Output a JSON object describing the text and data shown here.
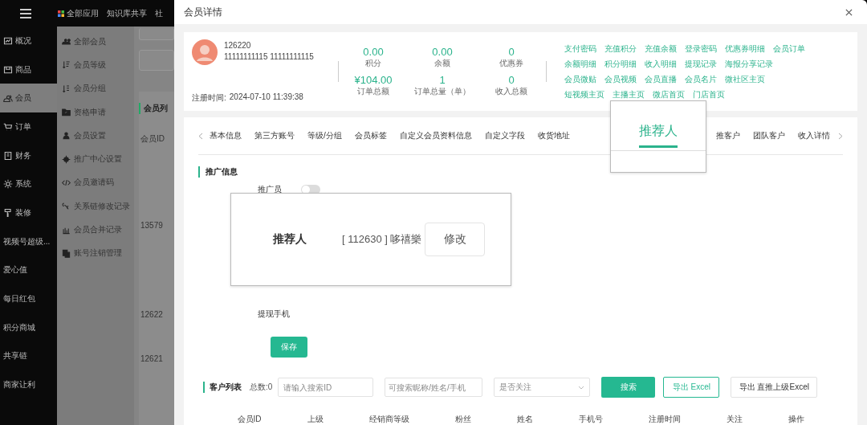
{
  "top_nav": {
    "items": [
      "全部应用",
      "知识库共享",
      "社"
    ]
  },
  "sidebar": {
    "items": [
      {
        "label": "概况",
        "selected": false
      },
      {
        "label": "商品",
        "selected": false
      },
      {
        "label": "会员",
        "selected": true
      },
      {
        "label": "订单",
        "selected": false
      },
      {
        "label": "财务",
        "selected": false
      },
      {
        "label": "系统",
        "selected": false
      },
      {
        "label": "装修",
        "selected": false
      },
      {
        "label": "视频号超级...",
        "selected": false
      },
      {
        "label": "爱心值",
        "selected": false
      },
      {
        "label": "每日红包",
        "selected": false
      },
      {
        "label": "积分商城",
        "selected": false
      },
      {
        "label": "共享链",
        "selected": false
      },
      {
        "label": "商家让利",
        "selected": false
      }
    ]
  },
  "submenu": {
    "items": [
      "全部会员",
      "会员等级",
      "会员分组",
      "资格申请",
      "会员设置",
      "推广中心设置",
      "会员邀请码",
      "关系链修改记录",
      "会员合并记录",
      "账号注销管理"
    ]
  },
  "background": {
    "list_title": "会员列",
    "column": "会员ID",
    "rows": [
      "13579",
      "12622",
      "12621"
    ]
  },
  "modal": {
    "title": "会员详情"
  },
  "member": {
    "id": "126220",
    "phones": "11111111115 11111111115",
    "registered_label": "注册时间:",
    "registered_at": "2024-07-10 11:39:38"
  },
  "stats": [
    {
      "value": "0.00",
      "label": "积分"
    },
    {
      "value": "0.00",
      "label": "余额"
    },
    {
      "value": "0",
      "label": "优惠券"
    },
    {
      "value": "¥104.00",
      "label": "订单总额"
    },
    {
      "value": "1",
      "label": "订单总量（单）"
    },
    {
      "value": "0",
      "label": "收入总额"
    }
  ],
  "link_rows": [
    [
      "支付密码",
      "充值积分",
      "充值余额",
      "登录密码",
      "优惠券明细",
      "会员订单"
    ],
    [
      "余额明细",
      "积分明细",
      "收入明细",
      "提现记录",
      "海报分享记录"
    ],
    [
      "会员微贴",
      "会员视频",
      "会员直播",
      "会员名片",
      "微社区主页"
    ],
    [
      "短视频主页",
      "主播主页",
      "微店首页",
      "门店首页"
    ]
  ],
  "tabs": [
    {
      "label": "基本信息",
      "selected": false
    },
    {
      "label": "第三方账号",
      "selected": false
    },
    {
      "label": "等级/分组",
      "selected": false
    },
    {
      "label": "会员标签",
      "selected": false
    },
    {
      "label": "自定义会员资料信息",
      "selected": false
    },
    {
      "label": "自定义字段",
      "selected": false
    },
    {
      "label": "收货地址",
      "selected": false
    },
    {
      "label": "推客户",
      "selected": false
    },
    {
      "label": "团队客户",
      "selected": false
    },
    {
      "label": "收入详情",
      "selected": false
    }
  ],
  "tab_callout": {
    "label": "推荐人",
    "selected": true
  },
  "section_title": "推广信息",
  "promoter": {
    "label": "推广员",
    "on": false
  },
  "referrer_callout": {
    "label": "推荐人",
    "value": "[ 112630 ] 哆禧樂",
    "button": "修改"
  },
  "withdraw_phone_label": "提现手机",
  "save_button": "保存",
  "customer_list": {
    "title": "客户列表",
    "total": "总数:0",
    "id_search": {
      "placeholder": "请输入搜索ID"
    },
    "name_search": {
      "placeholder": "可搜索昵称/姓名/手机"
    },
    "follow_select": {
      "placeholder": "是否关注"
    },
    "search_button": "搜索",
    "export_button": "导出 Excel",
    "export_parent_button": "导出 直推上级Excel"
  },
  "table": {
    "columns": [
      "会员ID",
      "上级",
      "经销商等级",
      "粉丝",
      "姓名",
      "手机号",
      "注册时间",
      "关注",
      "操作"
    ]
  }
}
